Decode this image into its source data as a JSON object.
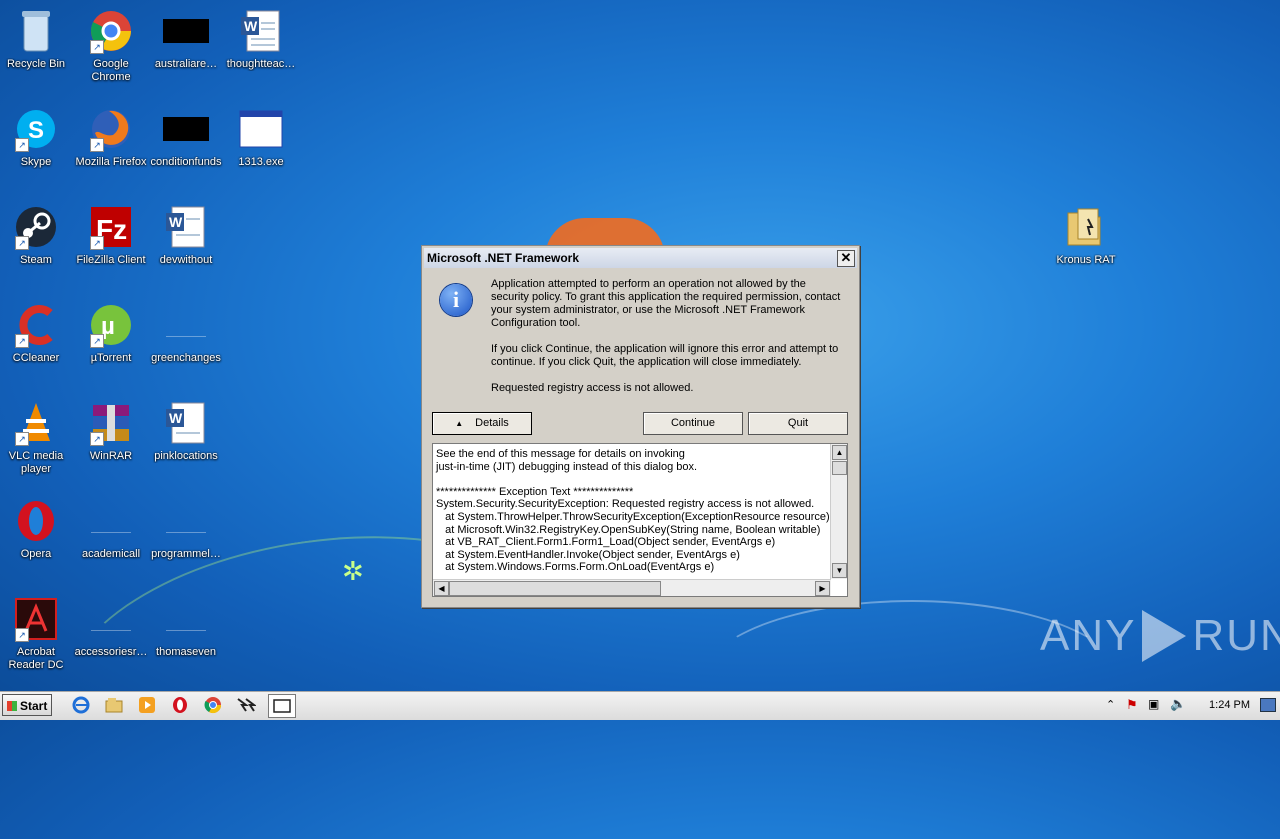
{
  "desktop": {
    "icons": [
      {
        "label": "Recycle Bin",
        "glyph": "🗑"
      },
      {
        "label": "Google Chrome",
        "glyph": "●"
      },
      {
        "label": "australiare…",
        "glyph": ""
      },
      {
        "label": "thoughtteac…",
        "glyph": "W"
      },
      {
        "label": "Skype",
        "glyph": "S"
      },
      {
        "label": "Mozilla Firefox",
        "glyph": "🦊"
      },
      {
        "label": "conditionfunds",
        "glyph": ""
      },
      {
        "label": "1313.exe",
        "glyph": ""
      },
      {
        "label": "Steam",
        "glyph": "⚙"
      },
      {
        "label": "FileZilla Client",
        "glyph": "Z"
      },
      {
        "label": "devwithout",
        "glyph": "W"
      },
      {
        "label": "CCleaner",
        "glyph": "C"
      },
      {
        "label": "µTorrent",
        "glyph": "µ"
      },
      {
        "label": "greenchanges",
        "glyph": ""
      },
      {
        "label": "VLC media player",
        "glyph": "▲"
      },
      {
        "label": "WinRAR",
        "glyph": "▤"
      },
      {
        "label": "pinklocations",
        "glyph": "W"
      },
      {
        "label": "Opera",
        "glyph": "O"
      },
      {
        "label": "academicall",
        "glyph": ""
      },
      {
        "label": "programmel…",
        "glyph": ""
      },
      {
        "label": "Acrobat Reader DC",
        "glyph": "A"
      },
      {
        "label": "accessoriesr…",
        "glyph": ""
      },
      {
        "label": "thomaseven",
        "glyph": ""
      },
      {
        "label": "Kronus RAT",
        "glyph": "📁"
      }
    ]
  },
  "dialog": {
    "title": "Microsoft .NET Framework",
    "close_label": "✕",
    "message_1": "Application attempted to perform an operation not allowed by the security policy. To grant this application the required permission, contact your system administrator, or use the Microsoft .NET Framework Configuration tool.",
    "message_2": "If you click Continue, the application will ignore this error and attempt to continue. If you click Quit, the application will close immediately.",
    "message_3": "Requested registry access is not allowed.",
    "details_label": "Details",
    "details_arrow": "▲",
    "continue_label": "Continue",
    "quit_label": "Quit",
    "details_text": "See the end of this message for details on invoking\njust-in-time (JIT) debugging instead of this dialog box.\n\n************** Exception Text **************\nSystem.Security.SecurityException: Requested registry access is not allowed.\n   at System.ThrowHelper.ThrowSecurityException(ExceptionResource resource)\n   at Microsoft.Win32.RegistryKey.OpenSubKey(String name, Boolean writable)\n   at VB_RAT_Client.Form1.Form1_Load(Object sender, EventArgs e)\n   at System.EventHandler.Invoke(Object sender, EventArgs e)\n   at System.Windows.Forms.Form.OnLoad(EventArgs e)"
  },
  "watermark": {
    "left": "ANY",
    "right": "RUN"
  },
  "taskbar": {
    "start_label": "Start",
    "clock": "1:24 PM",
    "tray_arrow": "⌃"
  },
  "colors": {
    "desktop": "#1f7fd8",
    "dialog_bg": "#d4d0c8",
    "taskbar": "#e6e6e6"
  }
}
